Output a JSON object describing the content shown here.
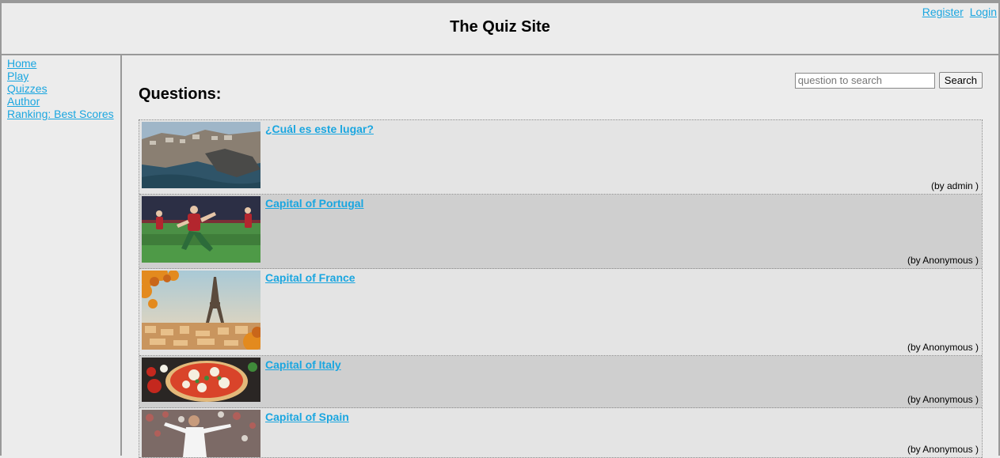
{
  "header": {
    "title": "The Quiz Site",
    "register_label": "Register",
    "login_label": "Login"
  },
  "sidebar": {
    "items": [
      {
        "label": "Home"
      },
      {
        "label": "Play"
      },
      {
        "label": "Quizzes"
      },
      {
        "label": "Author"
      },
      {
        "label": "Ranking: Best Scores"
      }
    ]
  },
  "search": {
    "placeholder": "question to search",
    "button_label": "Search"
  },
  "main": {
    "heading": "Questions:"
  },
  "questions": [
    {
      "title": "¿Cuál es este lugar?",
      "author": "(by admin )",
      "image": "coastal-town-photo"
    },
    {
      "title": "Capital of Portugal",
      "author": "(by Anonymous )",
      "image": "soccer-players-photo"
    },
    {
      "title": "Capital of France",
      "author": "(by Anonymous )",
      "image": "eiffel-tower-photo"
    },
    {
      "title": "Capital of Italy",
      "author": "(by Anonymous )",
      "image": "pizza-photo"
    },
    {
      "title": "Capital of Spain",
      "author": "(by Anonymous )",
      "image": "soccer-player-photo"
    }
  ],
  "colors": {
    "link": "#1aa6e0",
    "row_light": "#e4e4e4",
    "row_dark": "#cfcfcf",
    "border": "#999999"
  }
}
